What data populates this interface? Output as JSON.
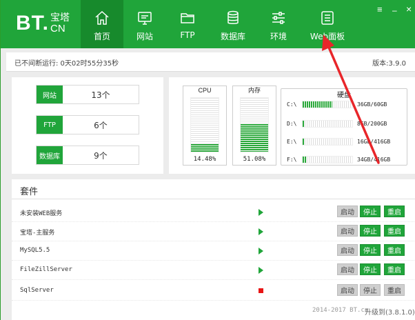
{
  "logo": {
    "bt": "BT.",
    "cn_top": "宝塔",
    "cn_bottom": "CN"
  },
  "nav": [
    {
      "label": "首页",
      "icon": "home-icon",
      "active": true
    },
    {
      "label": "网站",
      "icon": "monitor-icon"
    },
    {
      "label": "FTP",
      "icon": "folder-icon"
    },
    {
      "label": "数据库",
      "icon": "database-icon"
    },
    {
      "label": "环境",
      "icon": "sliders-icon"
    },
    {
      "label": "Web面板",
      "icon": "panel-icon"
    }
  ],
  "window": {
    "menu": "≡",
    "minimize": "–",
    "close": "×"
  },
  "status": {
    "uptime": "已不间断运行: 0天02时55分35秒",
    "version": "版本:3.9.0"
  },
  "counts": [
    {
      "label": "网站",
      "value": "13个"
    },
    {
      "label": "FTP",
      "value": "6个"
    },
    {
      "label": "数据库",
      "value": "9个"
    }
  ],
  "cpu": {
    "label": "CPU",
    "value": "14.48%",
    "percent": 14.48
  },
  "memory": {
    "label": "内存",
    "value": "51.08%",
    "percent": 51.08
  },
  "disk": {
    "title": "硬盘",
    "drives": [
      {
        "name": "C:\\",
        "usage": "36GB/60GB",
        "fraction": 0.6
      },
      {
        "name": "D:\\",
        "usage": "8GB/200GB",
        "fraction": 0.04
      },
      {
        "name": "E:\\",
        "usage": "16GB/416GB",
        "fraction": 0.04
      },
      {
        "name": "F:\\",
        "usage": "34GB/416GB",
        "fraction": 0.08
      }
    ]
  },
  "services": {
    "title": "套件",
    "start_label": "启动",
    "stop_label": "停止",
    "restart_label": "重启",
    "items": [
      {
        "name": "未安装WEB服务",
        "running": true
      },
      {
        "name": "宝塔-主服务",
        "running": true
      },
      {
        "name": "MySQL5.5",
        "running": true
      },
      {
        "name": "FileZillServer",
        "running": true
      },
      {
        "name": "SqlServer",
        "running": false
      }
    ]
  },
  "footer": {
    "copyright": "2014-2017 BT.cn",
    "update": "升级到(3.8.1.0)"
  },
  "colors": {
    "brand": "#20a53a",
    "active_tab": "#178a2c",
    "arrow": "#e8262a",
    "stopped": "#e81515"
  }
}
